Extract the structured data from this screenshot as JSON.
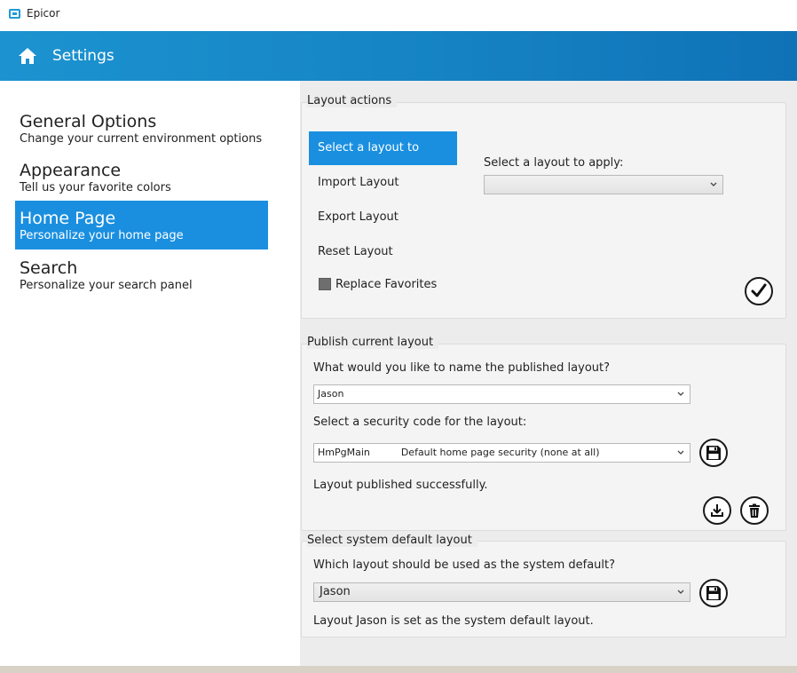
{
  "window": {
    "title": "Epicor"
  },
  "header": {
    "title": "Settings"
  },
  "nav": [
    {
      "title": "General Options",
      "subtitle": "Change your current environment options"
    },
    {
      "title": "Appearance",
      "subtitle": "Tell us your favorite colors"
    },
    {
      "title": "Home Page",
      "subtitle": "Personalize your home page"
    },
    {
      "title": "Search",
      "subtitle": "Personalize your search panel"
    }
  ],
  "layout_actions": {
    "title": "Layout actions",
    "items": [
      "Select a layout to apply:",
      "Import Layout",
      "Export Layout",
      "Reset Layout"
    ],
    "replace_favorites": "Replace Favorites",
    "select_label": "Select a layout to apply:",
    "select_value": ""
  },
  "publish": {
    "title": "Publish current layout",
    "name_label": "What would you like to name the published layout?",
    "name_value": "Jason",
    "security_label": "Select a security code for the layout:",
    "security_value": "HmPgMain          Default home page security (none at all)",
    "status": "Layout published successfully."
  },
  "system_default": {
    "title": "Select system default layout",
    "question": "Which layout should be used as the system default?",
    "value": "Jason",
    "status": "Layout Jason is set as the system default layout."
  },
  "colors": {
    "accent": "#1a8fe0",
    "header": "#1583c4"
  }
}
